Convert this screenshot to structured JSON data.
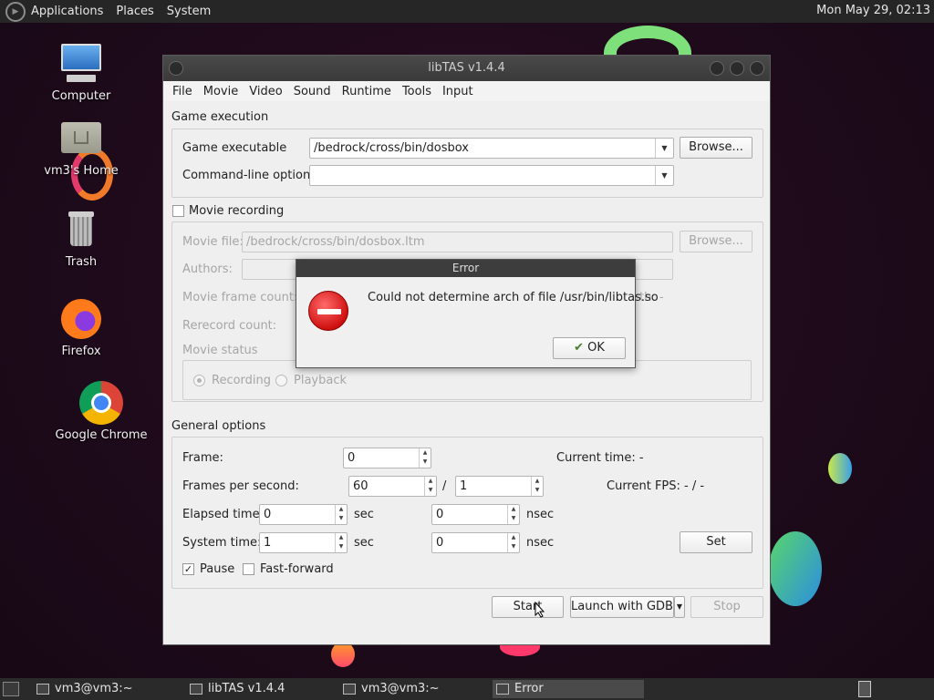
{
  "top_panel": {
    "menus": [
      "Applications",
      "Places",
      "System"
    ],
    "clock": "Mon May 29, 02:13"
  },
  "desktop_icons": [
    {
      "label": "Computer",
      "icon": "computer-icon"
    },
    {
      "label": "vm3's Home",
      "icon": "home-folder-icon"
    },
    {
      "label": "Trash",
      "icon": "trash-icon"
    },
    {
      "label": "Firefox",
      "icon": "firefox-icon"
    },
    {
      "label": "Google Chrome",
      "icon": "chrome-icon"
    }
  ],
  "window": {
    "title": "libTAS v1.4.4",
    "menu": [
      "File",
      "Movie",
      "Video",
      "Sound",
      "Runtime",
      "Tools",
      "Input"
    ],
    "game_execution": {
      "label": "Game execution",
      "executable_label": "Game executable",
      "executable_value": "/bedrock/cross/bin/dosbox",
      "browse_label": "Browse...",
      "cmdline_label": "Command-line options",
      "cmdline_value": ""
    },
    "movie": {
      "recording_label": "Movie recording",
      "recording_checked": false,
      "file_label": "Movie file:",
      "file_value": "/bedrock/cross/bin/dosbox.ltm",
      "browse_label": "Browse...",
      "authors_label": "Authors:",
      "frame_count_label": "Movie frame count:",
      "length_partial": "th: -",
      "rerecord_label": "Rerecord count:",
      "status_label": "Movie status",
      "recording_radio": "Recording",
      "playback_radio": "Playback"
    },
    "general": {
      "label": "General options",
      "frame_label": "Frame:",
      "frame_value": "0",
      "current_time": "Current time: -",
      "fps_label": "Frames per second:",
      "fps_num": "60",
      "fps_sep": "/",
      "fps_den": "1",
      "current_fps": "Current FPS: - / -",
      "elapsed_label": "Elapsed time:",
      "elapsed_sec": "0",
      "elapsed_nsec": "0",
      "system_label": "System time:",
      "system_sec": "1",
      "system_nsec": "0",
      "sec_unit": "sec",
      "nsec_unit": "nsec",
      "set_label": "Set",
      "pause_label": "Pause",
      "pause_checked": true,
      "ff_label": "Fast-forward",
      "ff_checked": false
    },
    "buttons": {
      "start": "Start",
      "gdb": "Launch with GDB",
      "stop": "Stop"
    }
  },
  "dialog": {
    "title": "Error",
    "message": "Could not determine arch of file /usr/bin/libtas.so",
    "ok_label": "OK"
  },
  "taskbar": {
    "tasks": [
      "vm3@vm3:~",
      "libTAS v1.4.4",
      "vm3@vm3:~",
      "Error"
    ]
  }
}
